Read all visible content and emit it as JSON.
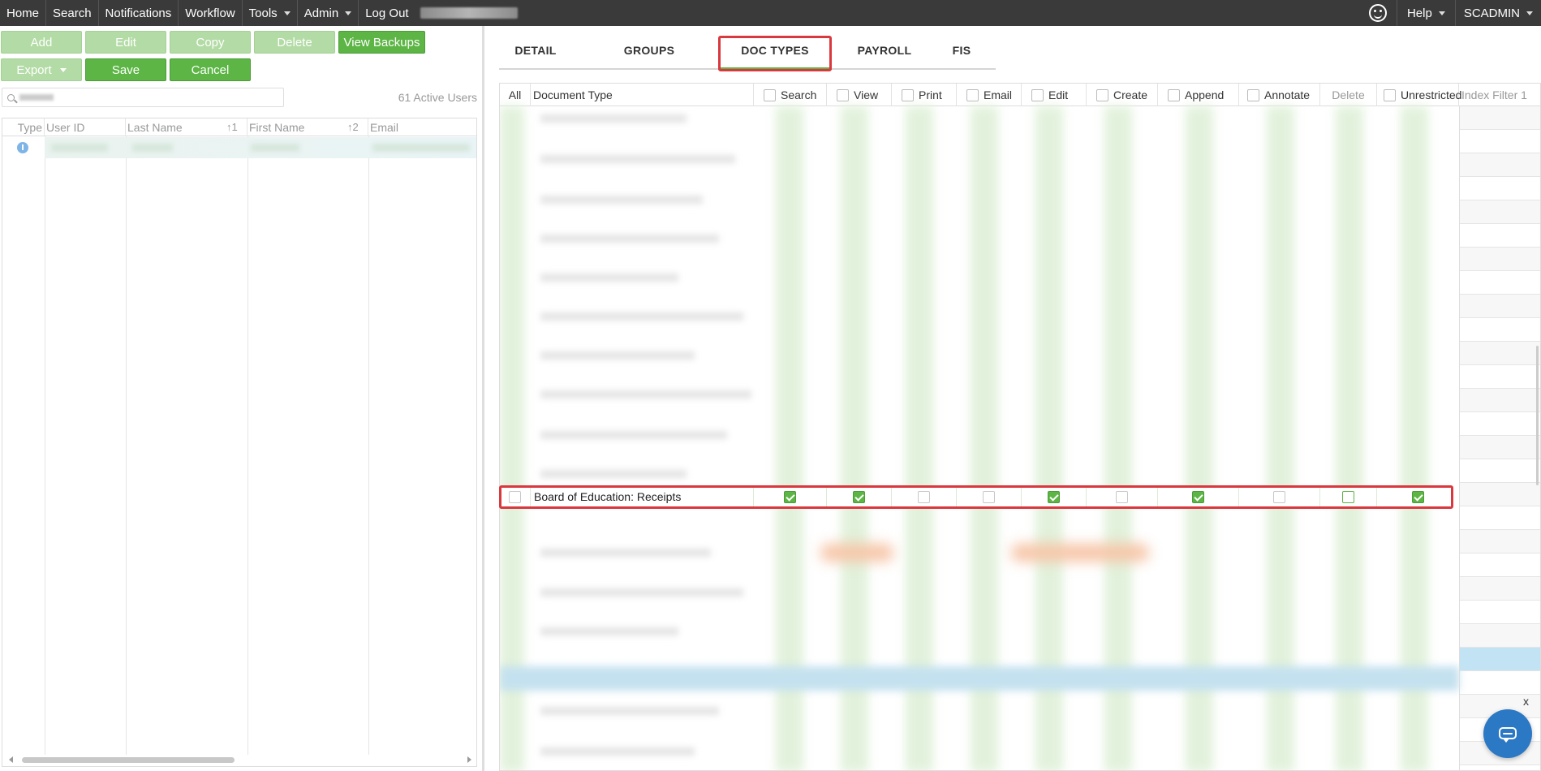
{
  "nav": {
    "items": [
      {
        "label": "Home",
        "dropdown": false
      },
      {
        "label": "Search",
        "dropdown": false
      },
      {
        "label": "Notifications",
        "dropdown": false
      },
      {
        "label": "Workflow",
        "dropdown": false
      },
      {
        "label": "Tools",
        "dropdown": true
      },
      {
        "label": "Admin",
        "dropdown": true
      },
      {
        "label": "Log Out",
        "dropdown": false
      }
    ],
    "help_label": "Help",
    "user_label": "SCADMIN",
    "feedback_icon": "smiley-icon"
  },
  "toolbar": {
    "add": "Add",
    "edit": "Edit",
    "copy": "Copy",
    "delete": "Delete",
    "view_backups": "View Backups",
    "export": "Export",
    "save": "Save",
    "cancel": "Cancel"
  },
  "users": {
    "active_count": "61 Active Users",
    "columns": [
      "Type",
      "User ID",
      "Last Name",
      "First Name",
      "Email"
    ],
    "sort_last": "↑1",
    "sort_first": "↑2",
    "row_icon": "info-icon"
  },
  "tabs": [
    {
      "label": "DETAIL",
      "active": false
    },
    {
      "label": "GROUPS",
      "active": false
    },
    {
      "label": "DOC TYPES",
      "active": true
    },
    {
      "label": "PAYROLL",
      "active": false
    },
    {
      "label": "FIS",
      "active": false
    }
  ],
  "doc_grid": {
    "headers": {
      "all": "All",
      "doc_type": "Document Type",
      "search": "Search",
      "view": "View",
      "print": "Print",
      "email": "Email",
      "edit": "Edit",
      "create": "Create",
      "append": "Append",
      "annotate": "Annotate",
      "delete": "Delete",
      "unrestricted": "Unrestricted",
      "index_filter": "Index Filter 1"
    },
    "highlighted_row": {
      "name": "Board of Education: Receipts",
      "search": true,
      "view": true,
      "print": false,
      "email": false,
      "edit": true,
      "create": false,
      "append": true,
      "annotate": false,
      "delete": false,
      "unrestricted": true
    }
  },
  "colors": {
    "accent_green": "#5cb545",
    "disabled_green": "#b3dba5",
    "highlight_red": "#d9383e",
    "nav_bg": "#3a3a3a",
    "chat_blue": "#2b78c5"
  },
  "widget": {
    "close_label": "x",
    "chat_icon": "chat-icon"
  }
}
